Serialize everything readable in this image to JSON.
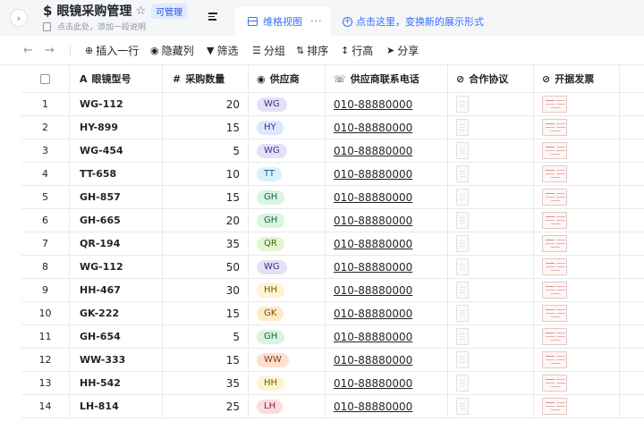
{
  "header": {
    "title": "眼镜采购管理",
    "permission_badge": "可管理",
    "subtitle": "点击此处，添加一段说明",
    "view_tab_label": "维格视图",
    "view_tab_more": "···",
    "switch_hint": "点击这里，变换新的展示形式"
  },
  "toolbar": {
    "insert_row": "插入一行",
    "hide_columns": "隐藏列",
    "filter": "筛选",
    "group": "分组",
    "sort": "排序",
    "row_height": "行高",
    "share": "分享"
  },
  "table": {
    "columns": {
      "model": "眼镜型号",
      "quantity": "采购数量",
      "supplier": "供应商",
      "phone": "供应商联系电话",
      "agreement": "合作协议",
      "invoice": "开据发票"
    },
    "rows": [
      {
        "index": "1",
        "model": "WG-112",
        "quantity": "20",
        "supplier": "WG",
        "phone": "010-88880000"
      },
      {
        "index": "2",
        "model": "HY-899",
        "quantity": "15",
        "supplier": "HY",
        "phone": "010-88880000"
      },
      {
        "index": "3",
        "model": "WG-454",
        "quantity": "5",
        "supplier": "WG",
        "phone": "010-88880000"
      },
      {
        "index": "4",
        "model": "TT-658",
        "quantity": "10",
        "supplier": "TT",
        "phone": "010-88880000"
      },
      {
        "index": "5",
        "model": "GH-857",
        "quantity": "15",
        "supplier": "GH",
        "phone": "010-88880000"
      },
      {
        "index": "6",
        "model": "GH-665",
        "quantity": "20",
        "supplier": "GH",
        "phone": "010-88880000"
      },
      {
        "index": "7",
        "model": "QR-194",
        "quantity": "35",
        "supplier": "QR",
        "phone": "010-88880000"
      },
      {
        "index": "8",
        "model": "WG-112",
        "quantity": "50",
        "supplier": "WG",
        "phone": "010-88880000"
      },
      {
        "index": "9",
        "model": "HH-467",
        "quantity": "30",
        "supplier": "HH",
        "phone": "010-88880000"
      },
      {
        "index": "10",
        "model": "GK-222",
        "quantity": "15",
        "supplier": "GK",
        "phone": "010-88880000"
      },
      {
        "index": "11",
        "model": "GH-654",
        "quantity": "5",
        "supplier": "GH",
        "phone": "010-88880000"
      },
      {
        "index": "12",
        "model": "WW-333",
        "quantity": "15",
        "supplier": "WW",
        "phone": "010-88880000"
      },
      {
        "index": "13",
        "model": "HH-542",
        "quantity": "35",
        "supplier": "HH",
        "phone": "010-88880000"
      },
      {
        "index": "14",
        "model": "LH-814",
        "quantity": "25",
        "supplier": "LH",
        "phone": "010-88880000"
      }
    ]
  },
  "supplier_colors": {
    "WG": {
      "bg": "#e4e1f7",
      "fg": "#3b2f8c"
    },
    "HY": {
      "bg": "#dde6fb",
      "fg": "#1d3f8f"
    },
    "TT": {
      "bg": "#d9f1fb",
      "fg": "#12607f"
    },
    "GH": {
      "bg": "#d9f3e4",
      "fg": "#16693c"
    },
    "QR": {
      "bg": "#e4f5d2",
      "fg": "#3e6b14"
    },
    "HH": {
      "bg": "#fdf3cf",
      "fg": "#7a5a05"
    },
    "GK": {
      "bg": "#fcebc8",
      "fg": "#7d4e05"
    },
    "WW": {
      "bg": "#fde0d0",
      "fg": "#8a3a12"
    },
    "LH": {
      "bg": "#fbdce2",
      "fg": "#8a1f36"
    }
  }
}
